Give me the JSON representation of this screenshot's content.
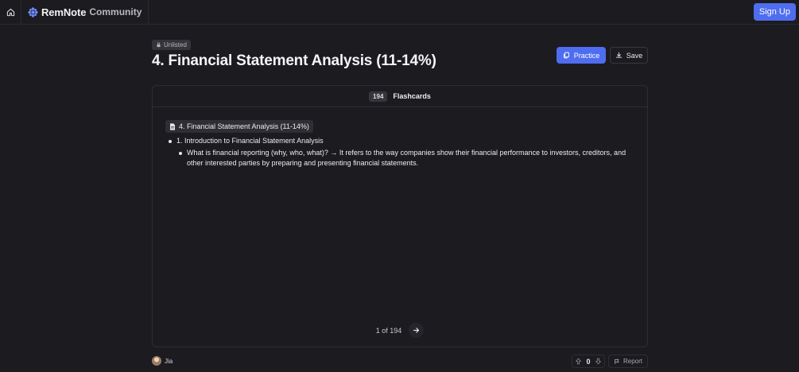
{
  "nav": {
    "brand": "RemNote",
    "brand_sub": "Community",
    "signup_label": "Sign Up"
  },
  "header": {
    "badge": "Unlisted",
    "title": "4. Financial Statement Analysis (11-14%)",
    "practice_label": "Practice",
    "save_label": "Save"
  },
  "card": {
    "count": "194",
    "count_label": "Flashcards",
    "doc_title": "4. Financial Statement Analysis (11-14%)",
    "items": [
      {
        "text": "1. Introduction to Financial Statement Analysis"
      },
      {
        "text": "What is financial reporting (why, who, what)? → It refers to the way companies show their financial performance to investors, creditors, and other interested parties by preparing and presenting financial statements."
      }
    ],
    "pager": "1 of 194"
  },
  "footer": {
    "author": "Jia",
    "votes": "0",
    "report_label": "Report"
  },
  "colors": {
    "background": "#1c1b20",
    "accent": "#4f6df0",
    "brand_icon": "#6f8cff"
  },
  "icons": {
    "home": "home-icon",
    "brand": "remnote-logo-icon",
    "lock": "lock-icon",
    "practice": "cards-icon",
    "save": "download-icon",
    "doc": "document-icon",
    "next": "arrow-right-icon",
    "upvote": "arrow-up-icon",
    "downvote": "arrow-down-icon",
    "report": "flag-icon"
  }
}
